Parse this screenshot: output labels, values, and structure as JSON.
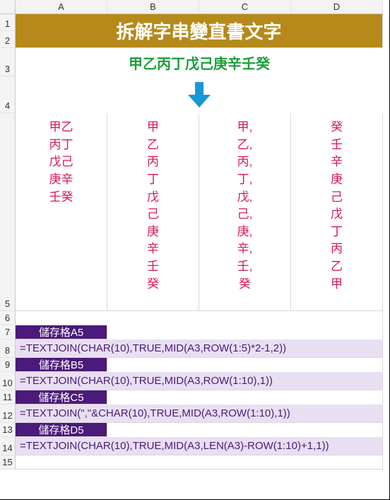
{
  "columns": [
    "A",
    "B",
    "C",
    "D"
  ],
  "rows": [
    "1",
    "2",
    "3",
    "4",
    "5",
    "6",
    "7",
    "8",
    "9",
    "10",
    "11",
    "12",
    "13",
    "14",
    "15"
  ],
  "title": "拆解字串變直書文字",
  "source_string": "甲乙丙丁戊己庚辛壬癸",
  "vertical_text": {
    "A5": "甲乙\n丙丁\n戊己\n庚辛\n壬癸",
    "B5": "甲\n乙\n丙\n丁\n戊\n己\n庚\n辛\n壬\n癸",
    "C5": "甲,\n乙,\n丙,\n丁,\n戊,\n己,\n庚,\n辛,\n壬,\n癸",
    "D5": "癸\n壬\n辛\n庚\n己\n戊\n丁\n丙\n乙\n甲"
  },
  "labels": {
    "A5": "儲存格A5",
    "B5": "儲存格B5",
    "C5": "儲存格C5",
    "D5": "儲存格D5"
  },
  "formulas": {
    "A5": "=TEXTJOIN(CHAR(10),TRUE,MID(A3,ROW(1:5)*2-1,2))",
    "B5": "=TEXTJOIN(CHAR(10),TRUE,MID(A3,ROW(1:10),1))",
    "C5": "=TEXTJOIN(\",\"&CHAR(10),TRUE,MID(A3,ROW(1:10),1))",
    "D5": "=TEXTJOIN(CHAR(10),TRUE,MID(A3,LEN(A3)-ROW(1:10)+1,1))"
  }
}
